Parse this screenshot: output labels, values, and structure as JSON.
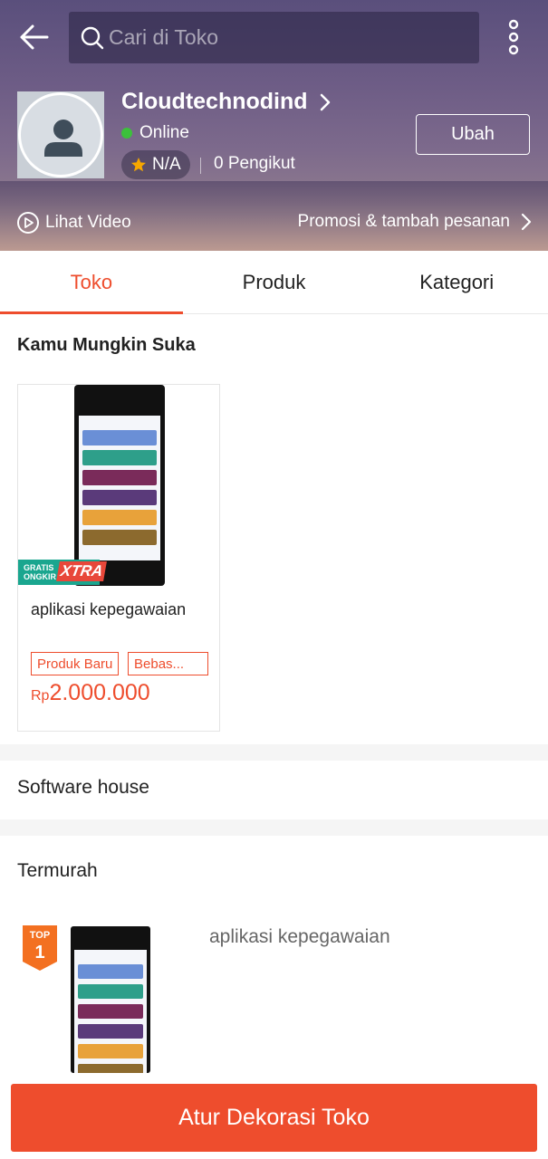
{
  "header": {
    "search_placeholder": "Cari di Toko",
    "shop_name": "Cloudtechnodind",
    "status": "Online",
    "rating": "N/A",
    "followers": "0 Pengikut",
    "edit_label": "Ubah",
    "video_label": "Lihat Video",
    "promo_label": "Promosi & tambah pesanan"
  },
  "tabs": [
    {
      "label": "Toko",
      "active": true
    },
    {
      "label": "Produk",
      "active": false
    },
    {
      "label": "Kategori",
      "active": false
    }
  ],
  "recommend": {
    "title": "Kamu Mungkin Suka",
    "product": {
      "badge_line1": "GRATIS",
      "badge_line2": "ONGKIR",
      "badge_xtra": "XTRA",
      "name": "aplikasi kepegawaian",
      "tags": [
        "Produk Baru",
        "Bebas..."
      ],
      "currency": "Rp",
      "price": "2.000.000"
    }
  },
  "sections": {
    "software_house": "Software house",
    "termurah": "Termurah"
  },
  "termurah_item": {
    "rank_label": "TOP",
    "rank": "1",
    "name": "aplikasi kepegawaian"
  },
  "cta_label": "Atur Dekorasi Toko",
  "colors": {
    "accent": "#ee4d2d",
    "online": "#3cc13b",
    "star": "#f6a700",
    "badge_green": "#1aa68f"
  },
  "icons": [
    "back-arrow-icon",
    "search-icon",
    "more-vertical-icon",
    "user-icon",
    "chevron-right-icon",
    "star-icon",
    "video-icon"
  ]
}
